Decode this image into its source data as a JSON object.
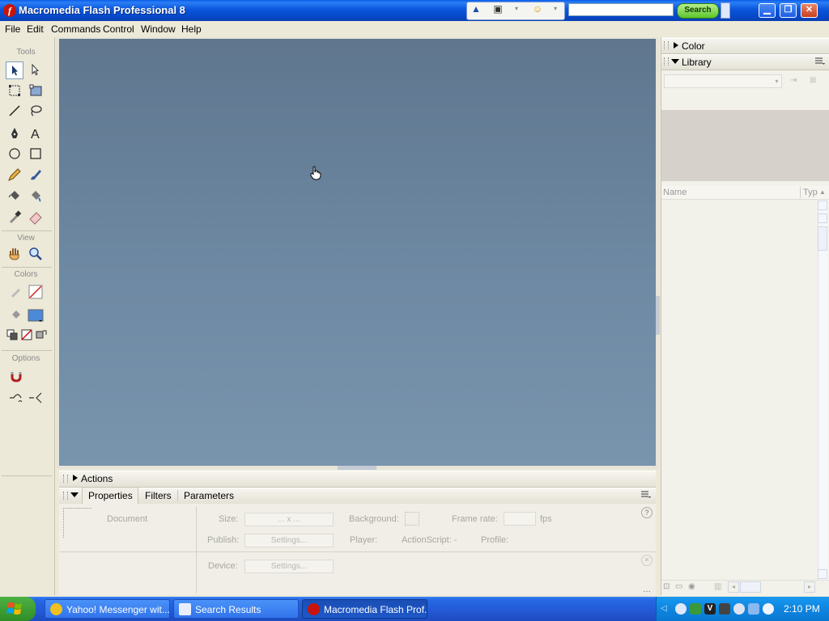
{
  "window": {
    "title": "Macromedia Flash Professional 8",
    "icon_letter": "f"
  },
  "toolbar_addon": {
    "search_button": "Search",
    "search_placeholder": ""
  },
  "menu": {
    "items": [
      "File",
      "Edit",
      "Commands",
      "Control",
      "Window",
      "Help"
    ]
  },
  "tools": {
    "sections": [
      "Tools",
      "View",
      "Colors",
      "Options"
    ]
  },
  "bottom_panels": {
    "actions_title": "Actions",
    "tabs": [
      "Properties",
      "Filters",
      "Parameters"
    ],
    "properties": {
      "document_label": "Document",
      "size_label": "Size:",
      "size_value": "... x ...",
      "background_label": "Background:",
      "frame_rate_label": "Frame rate:",
      "fps_unit": "fps",
      "publish_label": "Publish:",
      "publish_settings": "Settings...",
      "player_label": "Player:",
      "actionscript_label": "ActionScript: -",
      "profile_label": "Profile:",
      "device_label": "Device:",
      "device_settings": "Settings..."
    }
  },
  "right_panels": {
    "color_title": "Color",
    "library_title": "Library",
    "columns": [
      "Name",
      "Typ"
    ]
  },
  "taskbar": {
    "items": [
      {
        "label": "Yahoo! Messenger wit...",
        "active": false
      },
      {
        "label": "Search Results",
        "active": false
      },
      {
        "label": "Macromedia Flash Prof...",
        "active": true
      }
    ],
    "clock": "2:10 PM"
  },
  "colors": {
    "stage_top": "#5f768e",
    "stage_bottom": "#7994ad",
    "titlebar": "#0a56dc",
    "taskbar": "#2458d4"
  }
}
